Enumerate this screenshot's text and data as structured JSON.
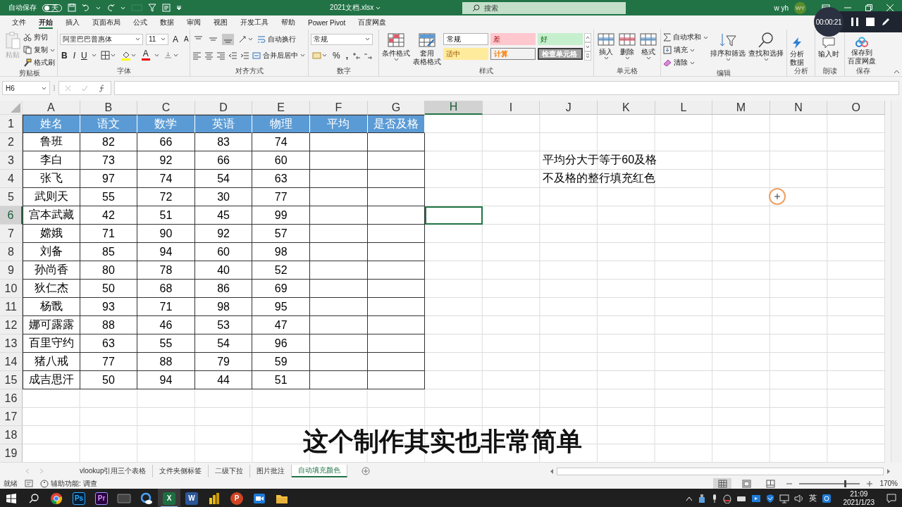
{
  "title_bar": {
    "autosave_label": "自动保存",
    "autosave_toggle": {
      "label": "关",
      "on": false
    },
    "file_name": "2021文档.xlsx",
    "search_placeholder": "搜索",
    "user_name": "w yh",
    "avatar_initials": "WY"
  },
  "recorder": {
    "time": "00:00:21"
  },
  "menu_tabs": [
    {
      "label": "文件",
      "selected": false
    },
    {
      "label": "开始",
      "selected": true
    },
    {
      "label": "插入",
      "selected": false
    },
    {
      "label": "页面布局",
      "selected": false
    },
    {
      "label": "公式",
      "selected": false
    },
    {
      "label": "数据",
      "selected": false
    },
    {
      "label": "审阅",
      "selected": false
    },
    {
      "label": "视图",
      "selected": false
    },
    {
      "label": "开发工具",
      "selected": false
    },
    {
      "label": "帮助",
      "selected": false
    },
    {
      "label": "Power Pivot",
      "selected": false
    },
    {
      "label": "百度网盘",
      "selected": false
    }
  ],
  "ribbon": {
    "clipboard": {
      "label": "剪贴板",
      "paste": {
        "label": "粘贴",
        "disabled": true
      },
      "cut": "剪切",
      "copy": "复制",
      "format_painter": "格式刷"
    },
    "font": {
      "label": "字体",
      "font_name": "阿里巴巴普惠体",
      "font_size": "11",
      "grow_font": "A",
      "shrink_font": "A",
      "bold": "B",
      "italic": "I",
      "underline": "U",
      "font_color": "A"
    },
    "alignment": {
      "label": "对齐方式",
      "vertical_align": [
        {
          "selected": false
        },
        {
          "selected": false
        },
        {
          "selected": true
        }
      ],
      "wrap_text": "自动换行",
      "merge_center": "合并后居中"
    },
    "number": {
      "label": "数字",
      "format": "常规",
      "percent": "%",
      "comma": ","
    },
    "styles": {
      "label": "样式",
      "conditional_formatting": "条件格式",
      "format_as_table": [
        "套用",
        "表格格式"
      ],
      "cell_styles": [
        {
          "label": "常规",
          "kind": "normal"
        },
        {
          "label": "差",
          "kind": "bad"
        },
        {
          "label": "好",
          "kind": "good"
        },
        {
          "label": "适中",
          "kind": "neutral"
        },
        {
          "label": "计算",
          "kind": "calculation"
        },
        {
          "label": "检查单元格",
          "kind": "check"
        }
      ]
    },
    "cells": {
      "label": "单元格",
      "insert": "插入",
      "delete": "删除",
      "format": "格式"
    },
    "editing": {
      "label": "编辑",
      "autosum": "自动求和",
      "fill": "填充",
      "clear": "清除",
      "sort_filter": "排序和筛选",
      "find_select": "查找和选择"
    },
    "analysis": {
      "label": "分析",
      "analyze_data": [
        "分析",
        "数据"
      ]
    },
    "read_aloud": {
      "label": "朗读",
      "button": "输入时"
    },
    "save": {
      "label": "保存",
      "button": [
        "保存到",
        "百度网盘"
      ]
    }
  },
  "formula_bar": {
    "name_box": "H6"
  },
  "sheet": {
    "columns": [
      {
        "label": "A",
        "selected": false
      },
      {
        "label": "B",
        "selected": false
      },
      {
        "label": "C",
        "selected": false
      },
      {
        "label": "D",
        "selected": false
      },
      {
        "label": "E",
        "selected": false
      },
      {
        "label": "F",
        "selected": false
      },
      {
        "label": "G",
        "selected": false
      },
      {
        "label": "H",
        "selected": true
      },
      {
        "label": "I",
        "selected": false
      },
      {
        "label": "J",
        "selected": false
      },
      {
        "label": "K",
        "selected": false
      },
      {
        "label": "L",
        "selected": false
      },
      {
        "label": "M",
        "selected": false
      },
      {
        "label": "N",
        "selected": false
      },
      {
        "label": "O",
        "selected": false
      }
    ],
    "rows": [
      {
        "label": "1",
        "selected": false
      },
      {
        "label": "2",
        "selected": false
      },
      {
        "label": "3",
        "selected": false
      },
      {
        "label": "4",
        "selected": false
      },
      {
        "label": "5",
        "selected": false
      },
      {
        "label": "6",
        "selected": true
      },
      {
        "label": "7",
        "selected": false
      },
      {
        "label": "8",
        "selected": false
      },
      {
        "label": "9",
        "selected": false
      },
      {
        "label": "10",
        "selected": false
      },
      {
        "label": "11",
        "selected": false
      },
      {
        "label": "12",
        "selected": false
      },
      {
        "label": "13",
        "selected": false
      },
      {
        "label": "14",
        "selected": false
      },
      {
        "label": "15",
        "selected": false
      },
      {
        "label": "16",
        "selected": false
      },
      {
        "label": "17",
        "selected": false
      },
      {
        "label": "18",
        "selected": false
      },
      {
        "label": "19",
        "selected": false
      }
    ],
    "table": {
      "header": [
        "姓名",
        "语文",
        "数学",
        "英语",
        "物理",
        "平均",
        "是否及格"
      ],
      "rows": [
        [
          "鲁班",
          "82",
          "66",
          "83",
          "74"
        ],
        [
          "李白",
          "73",
          "92",
          "66",
          "60"
        ],
        [
          "张飞",
          "97",
          "74",
          "54",
          "63"
        ],
        [
          "武则天",
          "55",
          "72",
          "30",
          "77"
        ],
        [
          "宫本武藏",
          "42",
          "51",
          "45",
          "99"
        ],
        [
          "嫦娥",
          "71",
          "90",
          "92",
          "57"
        ],
        [
          "刘备",
          "85",
          "94",
          "60",
          "98"
        ],
        [
          "孙尚香",
          "80",
          "78",
          "40",
          "52"
        ],
        [
          "狄仁杰",
          "50",
          "68",
          "86",
          "69"
        ],
        [
          "杨戬",
          "93",
          "71",
          "98",
          "95"
        ],
        [
          "娜可露露",
          "88",
          "46",
          "53",
          "47"
        ],
        [
          "百里守约",
          "63",
          "55",
          "54",
          "96"
        ],
        [
          "猪八戒",
          "77",
          "88",
          "79",
          "59"
        ],
        [
          "成吉思汗",
          "50",
          "94",
          "44",
          "51"
        ]
      ]
    },
    "notes": [
      "平均分大于等于60及格",
      "不及格的整行填充红色"
    ]
  },
  "caption": "这个制作其实也非常简单",
  "sheet_tabs": [
    {
      "label": "vlookup引用三个表格",
      "selected": false
    },
    {
      "label": "文件夹侧标签",
      "selected": false
    },
    {
      "label": "二级下拉",
      "selected": false
    },
    {
      "label": "图片批注",
      "selected": false
    },
    {
      "label": "自动填充颜色",
      "selected": true
    }
  ],
  "status_bar": {
    "mode": "就绪",
    "accessibility": "辅助功能: 调查",
    "view_buttons": [
      {
        "selected": true
      },
      {
        "selected": false
      },
      {
        "selected": false
      }
    ],
    "zoom_slider": {
      "level": 0.75
    },
    "zoom": "170%"
  },
  "taskbar": {
    "apps": [
      {
        "kind": "chrome",
        "active": false
      },
      {
        "kind": "photoshop",
        "label": "Ps",
        "active": false
      },
      {
        "kind": "premiere",
        "label": "Pr",
        "active": false
      },
      {
        "kind": "tablet",
        "active": false
      },
      {
        "kind": "cloud",
        "active": false
      },
      {
        "kind": "excel",
        "label": "X",
        "active": true
      },
      {
        "kind": "word",
        "label": "W",
        "active": false
      },
      {
        "kind": "bars",
        "active": false
      },
      {
        "kind": "powerpoint",
        "label": "P",
        "active": false
      },
      {
        "kind": "video",
        "active": false
      },
      {
        "kind": "folder",
        "active": false
      }
    ],
    "input_method": "英",
    "time": "21:09",
    "date": "2021/1/23"
  }
}
